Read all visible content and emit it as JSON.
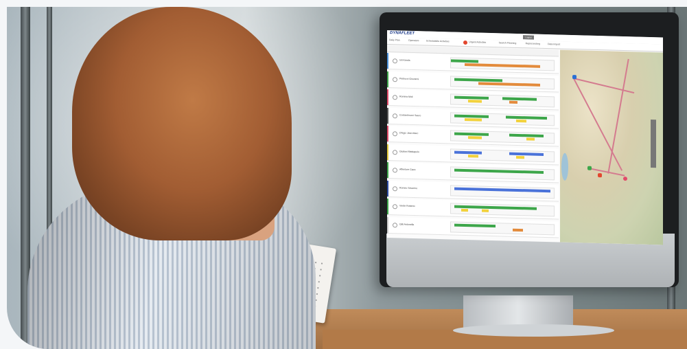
{
  "scene": {
    "description_tags": [
      "woman",
      "desktop-monitor",
      "office",
      "fleet-dispatch-app"
    ]
  },
  "screen_app": {
    "logo_text": "DYNAFLEET",
    "top_button": "Logout",
    "tabs": [
      {
        "label": "Daily Plan"
      },
      {
        "label": "Operators"
      },
      {
        "label": "Schedulable Activities"
      },
      {
        "label": "Urgent Activities",
        "badge": true
      },
      {
        "label": "Search Planning"
      },
      {
        "label": "Reprocessing"
      },
      {
        "label": "Data Import"
      }
    ],
    "rows": [
      {
        "name": "Ioli Kanda",
        "stripe": "#4a90d9"
      },
      {
        "name": "Pietrucci Giovanni",
        "stripe": "#3da64a"
      },
      {
        "name": "Romina Moli",
        "stripe": "#e24b6a"
      },
      {
        "name": "Costantinucci Sauro",
        "stripe": "#555555"
      },
      {
        "name": "D'Egiz Jean Marc",
        "stripe": "#e24b6a"
      },
      {
        "name": "Giuliani Mattiapolo",
        "stripe": "#e3c83a"
      },
      {
        "name": "Affentore Ciara",
        "stripe": "#3da64a"
      },
      {
        "name": "Romeo Severino",
        "stripe": "#2b4aa0"
      },
      {
        "name": "Verde Roberto",
        "stripe": "#3da64a"
      },
      {
        "name": "Gilli Antonella",
        "stripe": "#cccccc"
      }
    ],
    "colors": {
      "accent_green": "#3da64a",
      "accent_orange": "#e38b3c",
      "accent_yellow": "#f2d23c",
      "accent_blue": "#4a72d9",
      "badge_red": "#e2472f"
    }
  }
}
